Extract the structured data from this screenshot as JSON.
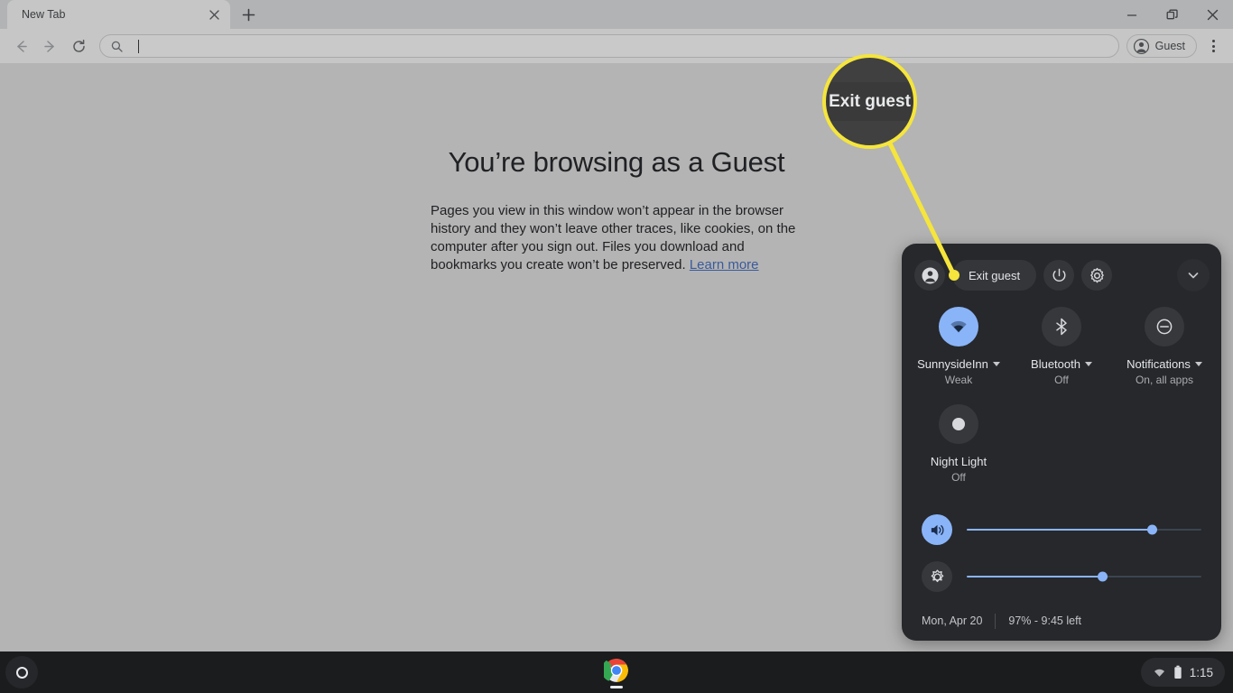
{
  "browser": {
    "tab": {
      "title": "New Tab",
      "close_icon": "close-icon"
    },
    "new_tab_icon": "plus-icon",
    "window_controls": [
      {
        "name": "minimize-button",
        "glyph": "—"
      },
      {
        "name": "restore-button",
        "glyph": "❐"
      },
      {
        "name": "close-button",
        "glyph": "✕"
      }
    ],
    "toolbar": {
      "back_icon": "arrow-back-icon",
      "forward_icon": "arrow-forward-icon",
      "reload_icon": "reload-icon",
      "omnibox": {
        "search_icon": "search-icon",
        "value": "",
        "placeholder": ""
      },
      "profile": {
        "label": "Guest",
        "icon": "account-circle-icon"
      },
      "menu_icon": "three-dot-menu-icon"
    }
  },
  "page": {
    "title": "You’re browsing as a Guest",
    "body": "Pages you view in this window won’t appear in the browser history and they won’t leave other traces, like cookies, on the computer after you sign out. Files you download and bookmarks you create won’t be preserved. ",
    "link": "Learn more"
  },
  "callout": {
    "magnified_label": "Exit guest",
    "ring_color": "#f5e53c",
    "line_color": "#f5e53c"
  },
  "tray": {
    "avatar_icon": "account-circle-icon",
    "exit_guest_label": "Exit guest",
    "power_icon": "power-icon",
    "settings_icon": "gear-icon",
    "collapse_icon": "chevron-down-icon",
    "tiles": [
      {
        "icon": "wifi-icon",
        "label": "SunnysideInn",
        "sub": "Weak",
        "active": true,
        "has_caret": true
      },
      {
        "icon": "bluetooth-icon",
        "label": "Bluetooth",
        "sub": "Off",
        "active": false,
        "has_caret": true
      },
      {
        "icon": "notifications-do-not-disturb-icon",
        "label": "Notifications",
        "sub": "On, all apps",
        "active": false,
        "has_caret": true
      },
      {
        "icon": "night-light-moon-icon",
        "label": "Night Light",
        "sub": "Off",
        "active": false,
        "has_caret": false
      }
    ],
    "sliders": [
      {
        "name": "volume",
        "icon": "volume-up-icon",
        "active": true,
        "percent": 79
      },
      {
        "name": "brightness",
        "icon": "brightness-icon",
        "active": false,
        "percent": 58
      }
    ],
    "footer": {
      "date": "Mon, Apr 20",
      "battery": "97% - 9:45 left"
    }
  },
  "shelf": {
    "launcher_icon": "launcher-circle-icon",
    "apps": [
      {
        "name": "chrome-app-icon",
        "label": "Chrome"
      }
    ],
    "status": {
      "wifi_icon": "wifi-icon",
      "battery_icon": "battery-icon",
      "time": "1:15"
    }
  },
  "colors": {
    "accent_blue": "#8ab4f8",
    "panel_bg": "#26282b",
    "shelf_bg": "#1b1c1e",
    "page_bg": "#b4b4b4",
    "highlight_yellow": "#f5e53c"
  }
}
